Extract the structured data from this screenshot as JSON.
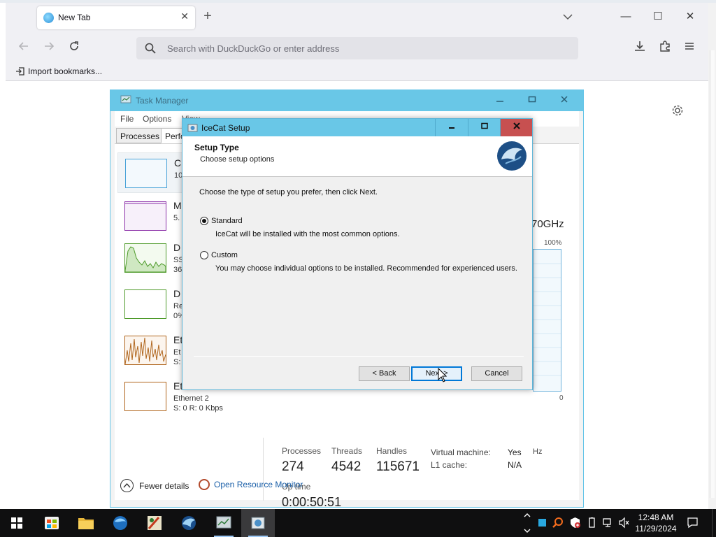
{
  "browser": {
    "tab_title": "New Tab",
    "tab_close": "✕",
    "new_tab": "+",
    "search_placeholder": "Search with DuckDuckGo or enter address",
    "bookmarks_item": "Import bookmarks...",
    "win_min": "—",
    "win_max": "☐",
    "win_close": "✕"
  },
  "taskmanager": {
    "title": "Task Manager",
    "menu": [
      "File",
      "Options",
      "View"
    ],
    "tabs": [
      "Processes",
      "Perfo"
    ],
    "side_items": [
      {
        "name": "C",
        "sub1": "10",
        "sub2": ""
      },
      {
        "name": "M",
        "sub1": "5.",
        "sub2": ""
      },
      {
        "name": "D",
        "sub1": "SS",
        "sub2": "36"
      },
      {
        "name": "D",
        "sub1": "Re",
        "sub2": "0%"
      },
      {
        "name": "Et",
        "sub1": "Et",
        "sub2": "S:"
      },
      {
        "name": "Et",
        "sub1": "Ethernet 2",
        "sub2": "S: 0 R: 0 Kbps"
      }
    ],
    "cpu_speed": "70GHz",
    "graph_max": "100%",
    "graph_min": "0",
    "ghz_fragment": "Hz",
    "stats": {
      "processes_label": "Processes",
      "processes_value": "274",
      "threads_label": "Threads",
      "threads_value": "4542",
      "handles_label": "Handles",
      "handles_value": "115671",
      "uptime_label": "Up time",
      "uptime_value": "0:00:50:51"
    },
    "vm": {
      "vm_label": "Virtual machine:",
      "vm_value": "Yes",
      "l1_label": "L1 cache:",
      "l1_value": "N/A"
    },
    "fewer_details": "Fewer details",
    "open_resource_monitor": "Open Resource Monitor"
  },
  "setup": {
    "title": "IceCat Setup",
    "heading": "Setup Type",
    "subheading": "Choose setup options",
    "intro": "Choose the type of setup you prefer, then click Next.",
    "options": [
      {
        "label": "Standard",
        "desc": "IceCat will be installed with the most common options.",
        "checked": true
      },
      {
        "label": "Custom",
        "desc": "You may choose individual options to be installed. Recommended for experienced users.",
        "checked": false
      }
    ],
    "back": "< Back",
    "next": "Next >",
    "cancel": "Cancel"
  },
  "taskbar": {
    "time": "12:48 AM",
    "date": "11/29/2024"
  },
  "colors": {
    "titlebar_accent": "#69c7e7",
    "close_red": "#c75050",
    "link_blue": "#1a5fa8"
  }
}
